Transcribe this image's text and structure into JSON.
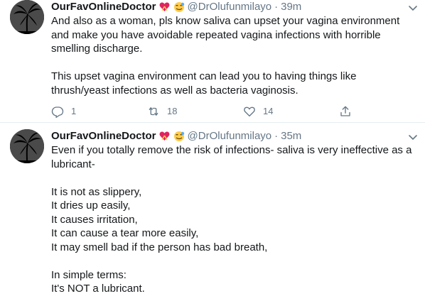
{
  "tweets": [
    {
      "name": "OurFavOnlineDoctor",
      "handle": "@DrOlufunmilayo",
      "separator": "·",
      "time": "39m",
      "paragraphs": [
        "And also as a woman, pls know saliva can upset your vagina environment and make you have avoidable repeated vagina infections with horrible smelling discharge.",
        "This upset vagina environment can lead you to having things like thrush/yeast infections as well as bacteria vaginosis."
      ],
      "reply_count": "1",
      "retweet_count": "18",
      "like_count": "14"
    },
    {
      "name": "OurFavOnlineDoctor",
      "handle": "@DrOlufunmilayo",
      "separator": "·",
      "time": "35m",
      "lines": [
        "Even if you totally remove the risk of infections- saliva is very ineffective as a lubricant-",
        "",
        "It is not as slippery,",
        "It dries up easily,",
        "It causes irritation,",
        "It can cause a tear more easily,",
        "It may smell bad if the person has bad breath,",
        "",
        "In simple terms:",
        "It's NOT a lubricant."
      ]
    }
  ],
  "icons": {
    "heart_emoji": "heart-with-ribbon-icon",
    "stethoscope_emoji": "doctor-face-icon",
    "reply": "reply-icon",
    "retweet": "retweet-icon",
    "like": "heart-outline-icon",
    "share": "share-icon",
    "more": "chevron-down-icon"
  },
  "colors": {
    "text": "#14171a",
    "secondary": "#657786",
    "divider": "#e6ecf0",
    "heart_emoji": "#e0245e"
  }
}
